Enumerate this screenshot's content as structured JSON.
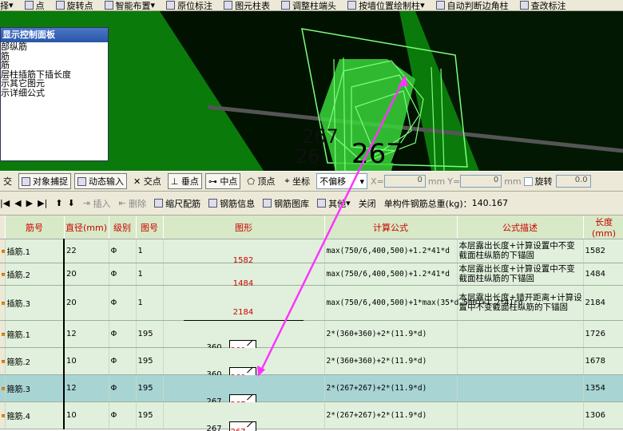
{
  "toolbar1": {
    "items": [
      "择",
      "点",
      "旋转点",
      "智能布置",
      "原位标注",
      "图元柱表",
      "调整柱端头",
      "按墙位置绘制柱",
      "自动判断边角柱",
      "查改标注"
    ]
  },
  "panel": {
    "title": "显示控制面板",
    "items": [
      "部纵筋",
      "筋",
      "筋",
      "层柱插筋下插长度",
      "示其它图元",
      "示详细公式"
    ]
  },
  "viewport": {
    "labels": [
      "267",
      "267",
      "26"
    ]
  },
  "toolbar2": {
    "items": [
      {
        "t": "交",
        "on": false
      },
      {
        "t": "对象捕捉",
        "on": true
      },
      {
        "t": "动态输入",
        "on": true
      },
      {
        "t": "交点",
        "on": false
      },
      {
        "t": "垂点",
        "on": true
      },
      {
        "t": "中点",
        "on": true
      },
      {
        "t": "顶点",
        "on": false
      },
      {
        "t": "坐标",
        "on": false
      }
    ],
    "offset": "不偏移",
    "xlabel": "X=",
    "xval": "0",
    "ylabel": "Y=",
    "yval": "0",
    "unit": "mm",
    "rotate": "旋转",
    "rotval": "0.0"
  },
  "toolbar3": {
    "insert": "插入",
    "delete": "删除",
    "scale": "缩尺配筋",
    "info": "钢筋信息",
    "lib": "钢筋图库",
    "other": "其他",
    "close": "关闭",
    "total_label": "单构件钢筋总重(kg)：",
    "total": "140.167"
  },
  "table": {
    "headers": [
      "筋号",
      "直径(mm)",
      "级别",
      "图号",
      "图形",
      "计算公式",
      "公式描述",
      "长度(mm)"
    ],
    "rows": [
      {
        "name": "插筋.1",
        "dia": "22",
        "grade": "Φ",
        "fig": "1",
        "shape": "line",
        "v1": "1582",
        "formula": "max(750/6,400,500)+1.2*41*d",
        "desc": "本层露出长度+计算设置中不变截面柱纵筋的下锚固",
        "len": "1582",
        "sel": false
      },
      {
        "name": "插筋.2",
        "dia": "20",
        "grade": "Φ",
        "fig": "1",
        "shape": "line",
        "v1": "1484",
        "formula": "max(750/6,400,500)+1.2*41*d",
        "desc": "本层露出长度+计算设置中不变截面柱纵筋的下锚固",
        "len": "1484",
        "sel": false
      },
      {
        "name": "插筋.3",
        "dia": "20",
        "grade": "Φ",
        "fig": "1",
        "shape": "line",
        "v1": "2184",
        "formula": "max(750/6,400,500)+1*max(35*d,500)+1.2*41*d",
        "desc": "本层露出长度+错开距离+计算设置中不变截面柱纵筋的下锚固",
        "len": "2184",
        "sel": false
      },
      {
        "name": "箍筋.1",
        "dia": "12",
        "grade": "Φ",
        "fig": "195",
        "shape": "hook",
        "v1": "360",
        "v2": "360",
        "formula": "2*(360+360)+2*(11.9*d)",
        "desc": "",
        "len": "1726",
        "sel": false
      },
      {
        "name": "箍筋.2",
        "dia": "10",
        "grade": "Φ",
        "fig": "195",
        "shape": "hook",
        "v1": "360",
        "v2": "360",
        "formula": "2*(360+360)+2*(11.9*d)",
        "desc": "",
        "len": "1678",
        "sel": false
      },
      {
        "name": "箍筋.3",
        "dia": "12",
        "grade": "Φ",
        "fig": "195",
        "shape": "hook",
        "v1": "267",
        "v2": "267",
        "formula": "2*(267+267)+2*(11.9*d)",
        "desc": "",
        "len": "1354",
        "sel": true
      },
      {
        "name": "箍筋.4",
        "dia": "10",
        "grade": "Φ",
        "fig": "195",
        "shape": "hook",
        "v1": "267",
        "v2": "267",
        "formula": "2*(267+267)+2*(11.9*d)",
        "desc": "",
        "len": "1306",
        "sel": false
      }
    ]
  },
  "colors": {
    "viewport": "#0a7a0a",
    "arrow": "#ff33ff",
    "header_bg": "#d7e9c6",
    "row_bg": "#e0f0dc",
    "selected_row": "#a8d4d4"
  }
}
